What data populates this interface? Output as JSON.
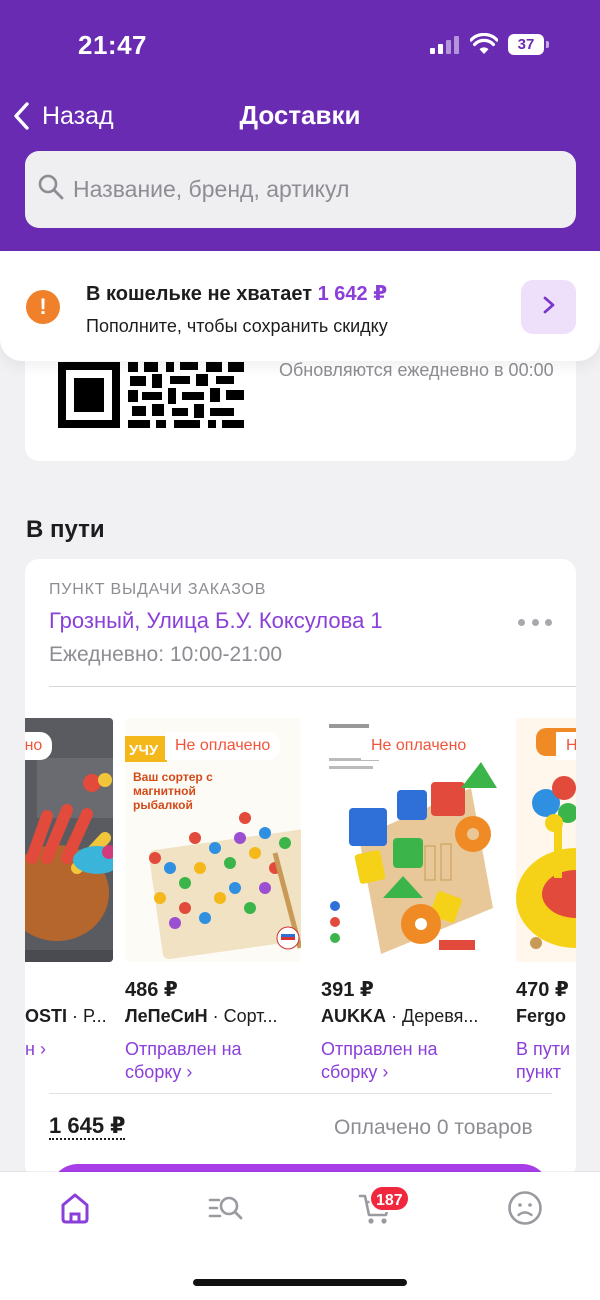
{
  "status_bar": {
    "time": "21:47",
    "battery": "37"
  },
  "nav": {
    "back_label": "Назад",
    "title": "Доставки"
  },
  "search": {
    "placeholder": "Название, бренд, артикул"
  },
  "wallet_banner": {
    "title_prefix": "В кошельке не хватает",
    "amount": "1 642 ₽",
    "subtitle": "Пополните, чтобы сохранить скидку"
  },
  "qr_card": {
    "note": "Обновляются ежедневно в 00:00"
  },
  "in_transit": {
    "section_title": "В пути",
    "pickup_label": "ПУНКТ ВЫДАЧИ ЗАКАЗОВ",
    "pickup_address": "Грозный, Улица Б.У. Коксулова 1",
    "pickup_hours": "Ежедневно: 10:00-21:00",
    "products": [
      {
        "badge": "Не оплачено",
        "price": "",
        "brand": "OSTI",
        "name": "Р...",
        "status": "н ›"
      },
      {
        "badge": "Не оплачено",
        "price": "486 ₽",
        "brand": "ЛеПеСиН",
        "name": "Сорт...",
        "status": "Отправлен на сборку ›",
        "thumb_text": "Ваш сортер с магнитной рыбалкой"
      },
      {
        "badge": "Не оплачено",
        "price": "391 ₽",
        "brand": "AUKKA",
        "name": "Деревя...",
        "status": "Отправлен на сборку ›"
      },
      {
        "badge": "Н",
        "price": "470 ₽",
        "brand": "Fergo",
        "name": "",
        "status": "В пути пункт"
      }
    ],
    "total": "1 645 ₽",
    "paid_text": "Оплачено 0 товаров"
  },
  "tabbar": {
    "cart_count": "187"
  },
  "colors": {
    "brand": "#6a2bb3",
    "accent": "#8b3fd9",
    "warning": "#f0812a",
    "badge": "#f0273d"
  }
}
